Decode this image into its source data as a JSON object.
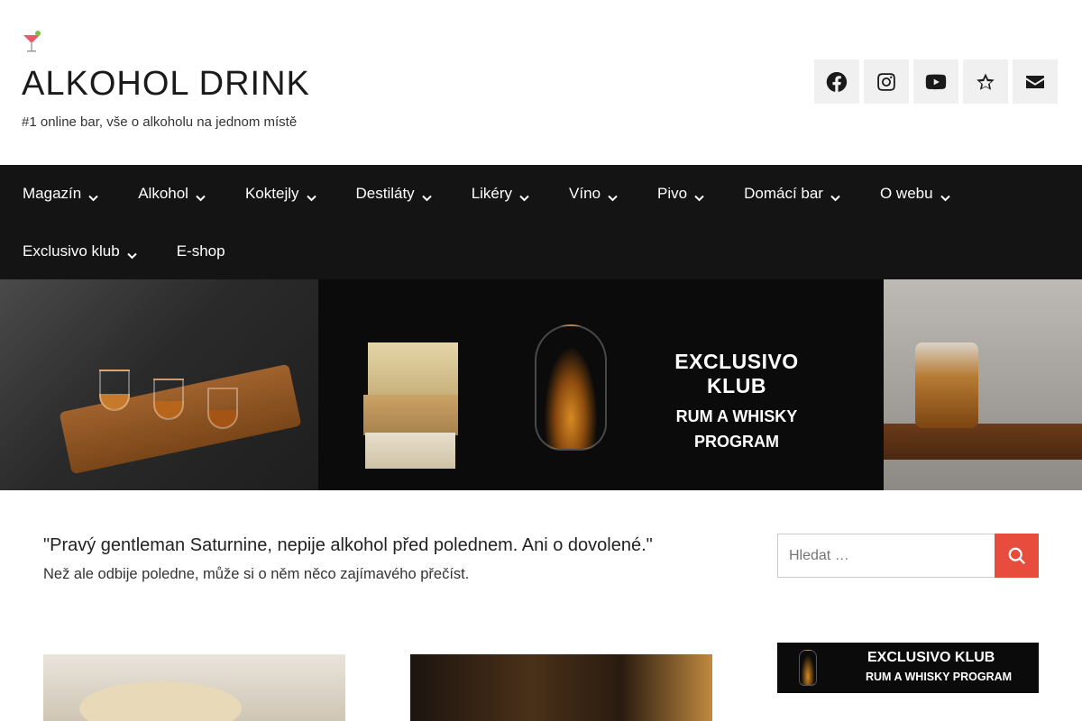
{
  "header": {
    "title": "ALKOHOL DRINK",
    "tagline": "#1 online bar, vše o alkoholu na jednom místě",
    "logo_icon": "cocktail-glass-icon",
    "social": [
      {
        "name": "facebook-icon"
      },
      {
        "name": "instagram-icon"
      },
      {
        "name": "youtube-icon"
      },
      {
        "name": "star-icon"
      },
      {
        "name": "envelope-icon"
      }
    ]
  },
  "nav": {
    "items": [
      {
        "label": "Magazín"
      },
      {
        "label": "Alkohol"
      },
      {
        "label": "Koktejly"
      },
      {
        "label": "Destiláty"
      },
      {
        "label": "Likéry"
      },
      {
        "label": "Víno"
      },
      {
        "label": "Pivo"
      },
      {
        "label": "Domácí bar"
      },
      {
        "label": "O webu"
      },
      {
        "label": "Exclusivo klub"
      },
      {
        "label": "E-shop"
      }
    ]
  },
  "banner": {
    "line1": "EXCLUSIVO KLUB",
    "line2": "RUM A WHISKY",
    "line3": "PROGRAM"
  },
  "main": {
    "quote": "\"Pravý gentleman Saturnine, nepije alkohol před polednem. Ani o dovolené.\"",
    "subtitle": "Než ale odbije poledne, může si o něm něco zajímavého přečíst."
  },
  "sidebar": {
    "search_placeholder": "Hledat …",
    "banner_line1": "EXCLUSIVO KLUB",
    "banner_line2": "RUM A WHISKY PROGRAM"
  },
  "colors": {
    "nav_bg": "#141414",
    "accent": "#e84c3d",
    "social_bg": "#f0f0f0"
  }
}
